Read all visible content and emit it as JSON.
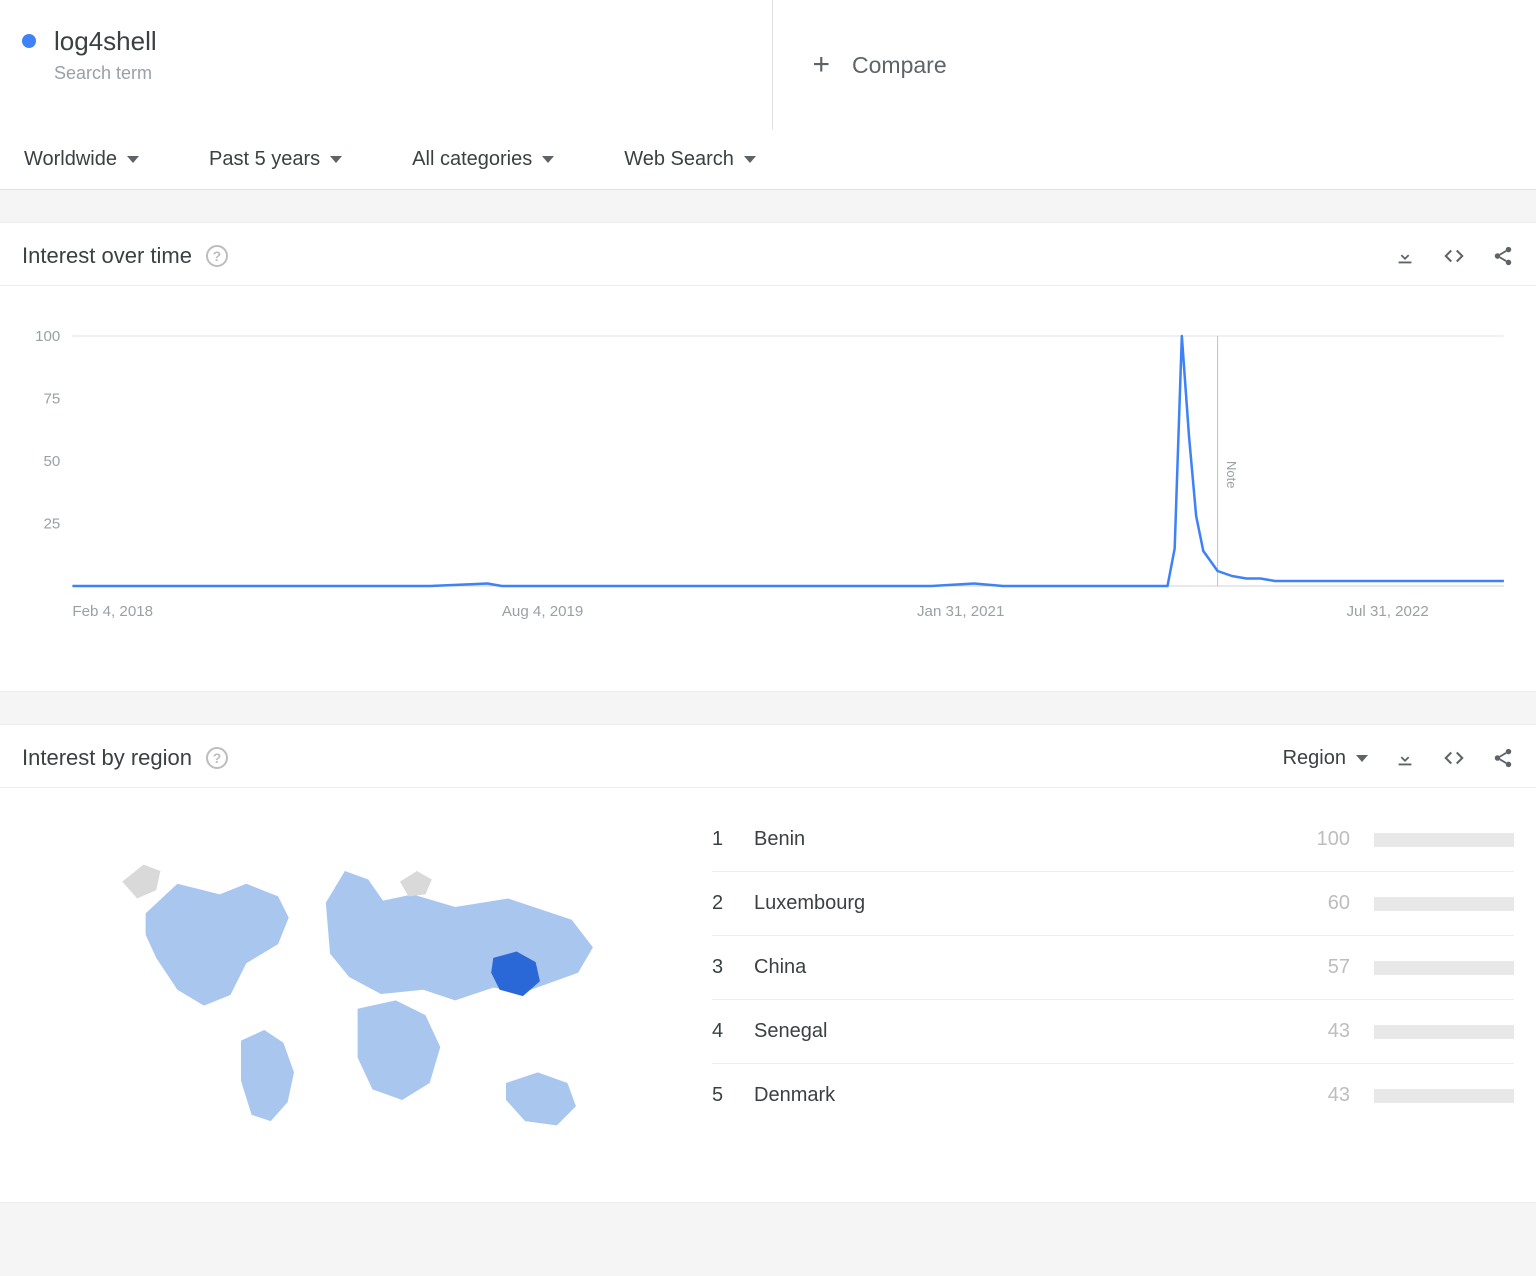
{
  "term": "log4shell",
  "term_subtitle": "Search term",
  "compare_label": "Compare",
  "filters": {
    "geo": "Worldwide",
    "time": "Past 5 years",
    "category": "All categories",
    "search_type": "Web Search"
  },
  "panels": {
    "iot": {
      "title": "Interest over time",
      "note": "Note"
    },
    "ibr": {
      "title": "Interest by region",
      "selector": "Region"
    }
  },
  "chart_data": {
    "type": "line",
    "title": "Interest over time",
    "ylabel": "",
    "xlabel": "",
    "ylim": [
      0,
      100
    ],
    "y_ticks": [
      25,
      50,
      75,
      100
    ],
    "x_ticks": [
      "Feb 4, 2018",
      "Aug 4, 2019",
      "Jan 31, 2021",
      "Jul 31, 2022"
    ],
    "x_tick_positions": [
      0.0,
      0.3,
      0.59,
      0.89
    ],
    "note_position": 0.8,
    "series": [
      {
        "name": "log4shell",
        "color": "#3f82f7",
        "points": [
          {
            "x": 0.0,
            "y": 0
          },
          {
            "x": 0.05,
            "y": 0
          },
          {
            "x": 0.1,
            "y": 0
          },
          {
            "x": 0.15,
            "y": 0
          },
          {
            "x": 0.2,
            "y": 0
          },
          {
            "x": 0.25,
            "y": 0
          },
          {
            "x": 0.29,
            "y": 1
          },
          {
            "x": 0.3,
            "y": 0
          },
          {
            "x": 0.35,
            "y": 0
          },
          {
            "x": 0.4,
            "y": 0
          },
          {
            "x": 0.45,
            "y": 0
          },
          {
            "x": 0.5,
            "y": 0
          },
          {
            "x": 0.55,
            "y": 0
          },
          {
            "x": 0.6,
            "y": 0
          },
          {
            "x": 0.63,
            "y": 1
          },
          {
            "x": 0.65,
            "y": 0
          },
          {
            "x": 0.7,
            "y": 0
          },
          {
            "x": 0.75,
            "y": 0
          },
          {
            "x": 0.765,
            "y": 0
          },
          {
            "x": 0.77,
            "y": 15
          },
          {
            "x": 0.775,
            "y": 100
          },
          {
            "x": 0.78,
            "y": 60
          },
          {
            "x": 0.785,
            "y": 28
          },
          {
            "x": 0.79,
            "y": 14
          },
          {
            "x": 0.8,
            "y": 6
          },
          {
            "x": 0.81,
            "y": 4
          },
          {
            "x": 0.82,
            "y": 3
          },
          {
            "x": 0.83,
            "y": 3
          },
          {
            "x": 0.84,
            "y": 2
          },
          {
            "x": 0.86,
            "y": 2
          },
          {
            "x": 0.88,
            "y": 2
          },
          {
            "x": 0.9,
            "y": 2
          },
          {
            "x": 0.92,
            "y": 2
          },
          {
            "x": 0.94,
            "y": 2
          },
          {
            "x": 0.96,
            "y": 2
          },
          {
            "x": 0.98,
            "y": 2
          },
          {
            "x": 1.0,
            "y": 2
          }
        ]
      }
    ]
  },
  "regions": [
    {
      "rank": 1,
      "name": "Benin",
      "value": 100
    },
    {
      "rank": 2,
      "name": "Luxembourg",
      "value": 60
    },
    {
      "rank": 3,
      "name": "China",
      "value": 57
    },
    {
      "rank": 4,
      "name": "Senegal",
      "value": 43
    },
    {
      "rank": 5,
      "name": "Denmark",
      "value": 43
    }
  ]
}
